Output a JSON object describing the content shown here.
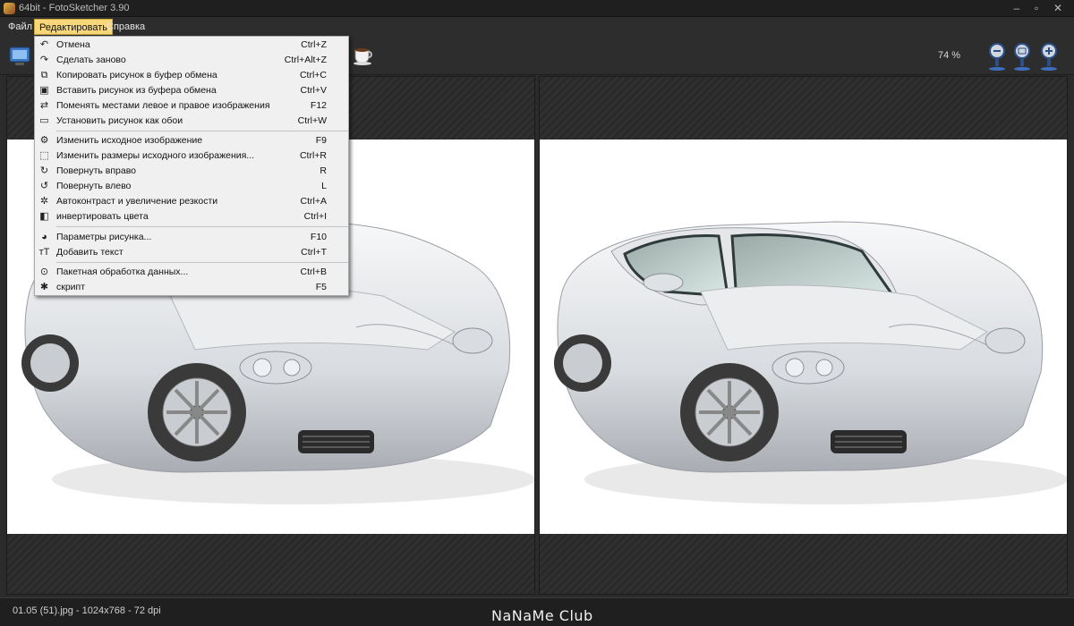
{
  "window": {
    "title": "64bit - FotoSketcher 3.90",
    "controls": [
      "–",
      "▫",
      "✕"
    ]
  },
  "menubar": {
    "items": [
      "Файл",
      "Редактировать",
      "Справка"
    ]
  },
  "toolbar": {
    "zoom_value": "74 %"
  },
  "edit_menu": {
    "items": [
      {
        "icon": "undo-icon",
        "label": "Отмена",
        "shortcut": "Ctrl+Z"
      },
      {
        "icon": "redo-icon",
        "label": "Сделать заново",
        "shortcut": "Ctrl+Alt+Z"
      },
      {
        "icon": "copy-icon",
        "label": "Копировать рисунок в буфер обмена",
        "shortcut": "Ctrl+C"
      },
      {
        "icon": "paste-icon",
        "label": "Вставить рисунок из буфера обмена",
        "shortcut": "Ctrl+V"
      },
      {
        "icon": "swap-icon",
        "label": "Поменять местами левое и правое изображения",
        "shortcut": "F12"
      },
      {
        "icon": "monitor-icon",
        "label": "Установить рисунок как обои",
        "shortcut": "Ctrl+W"
      },
      {
        "icon": "gear-icon",
        "label": "Изменить исходное изображение",
        "shortcut": "F9"
      },
      {
        "icon": "resize-icon",
        "label": "Изменить размеры исходного изображения...",
        "shortcut": "Ctrl+R"
      },
      {
        "icon": "rotate-right-icon",
        "label": "Повернуть вправо",
        "shortcut": "R"
      },
      {
        "icon": "rotate-left-icon",
        "label": "Повернуть влево",
        "shortcut": "L"
      },
      {
        "icon": "settings-icon",
        "label": "Автоконтраст и увеличение резкости",
        "shortcut": "Ctrl+A"
      },
      {
        "icon": "invert-icon",
        "label": "инвертировать цвета",
        "shortcut": "Ctrl+I"
      },
      {
        "icon": "palette-icon",
        "label": "Параметры рисунка...",
        "shortcut": "F10"
      },
      {
        "icon": "text-icon",
        "label": "Добавить текст",
        "shortcut": "Ctrl+T"
      },
      {
        "icon": "batch-icon",
        "label": "Пакетная обработка данных...",
        "shortcut": "Ctrl+B"
      },
      {
        "icon": "script-icon",
        "label": "скрипт",
        "shortcut": "F5"
      }
    ]
  },
  "status": {
    "file_info": "01.05 (51).jpg - 1024x768 - 72 dpi",
    "watermark": "NaNaMe Club"
  },
  "colors": {
    "menu_highlight": "#f7d77a",
    "background": "#2b2b2b",
    "car_body": "#e3e5e8"
  }
}
